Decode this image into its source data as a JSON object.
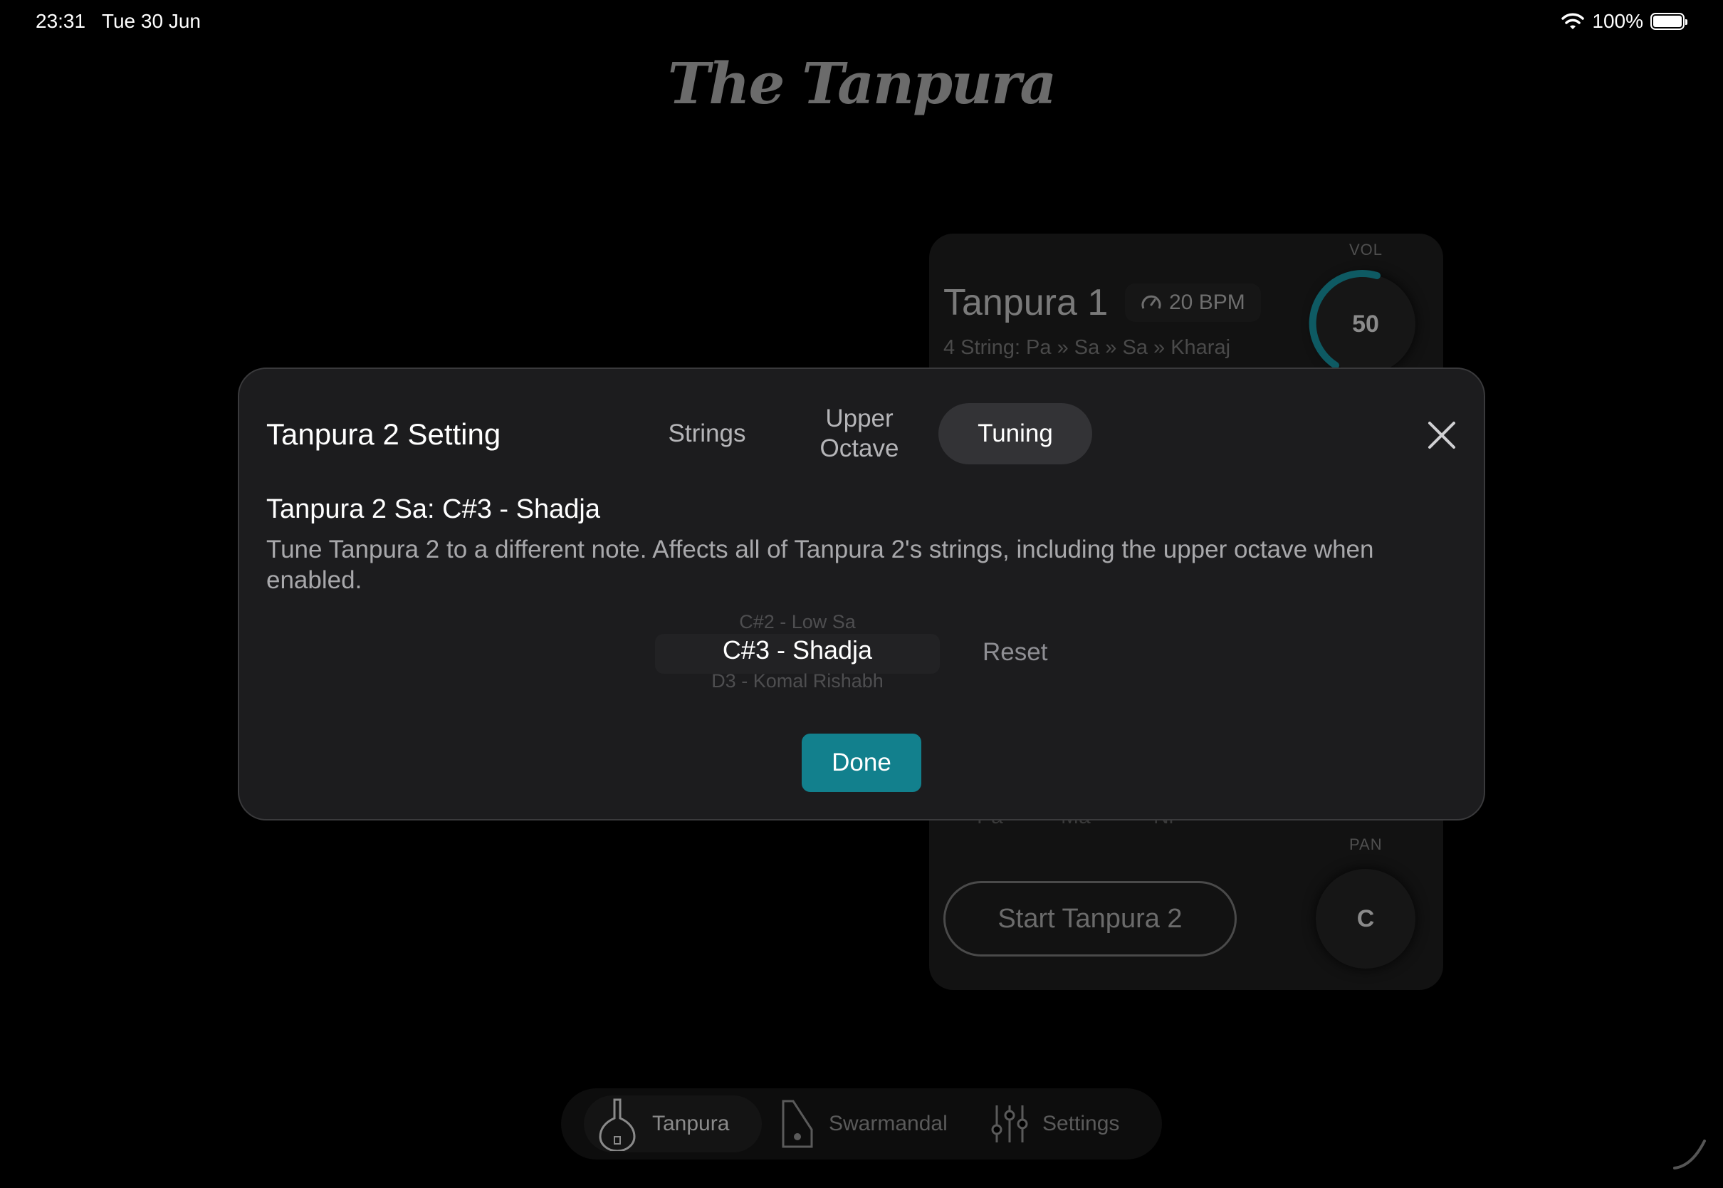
{
  "status": {
    "time": "23:31",
    "date": "Tue 30 Jun",
    "battery": "100%"
  },
  "app": {
    "logo": "The Tanpura"
  },
  "background_card": {
    "title": "Tanpura 1",
    "bpm": "20 BPM",
    "strings_summary": "4 String: Pa » Sa » Sa » Kharaj",
    "vol_label": "VOL",
    "vol_value": "50",
    "string_buttons": [
      "Pa",
      "Ma",
      "Ni"
    ],
    "pan_label": "PAN",
    "pan_value": "C",
    "start_button": "Start Tanpura 2"
  },
  "tabbar": {
    "items": [
      {
        "label": "Tanpura",
        "icon": "tanpura-icon",
        "active": true
      },
      {
        "label": "Swarmandal",
        "icon": "swarmandal-icon",
        "active": false
      },
      {
        "label": "Settings",
        "icon": "sliders-icon",
        "active": false
      }
    ]
  },
  "modal": {
    "title": "Tanpura 2 Setting",
    "tabs": [
      {
        "label": "Strings",
        "active": false
      },
      {
        "label": "Upper\nOctave",
        "active": false
      },
      {
        "label": "Tuning",
        "active": true
      }
    ],
    "close_icon": "close-icon",
    "sa_heading": "Tanpura 2 Sa: C#3 - Shadja",
    "description": "Tune Tanpura 2 to a different note. Affects all of Tanpura 2's strings, including the upper octave when enabled.",
    "picker": {
      "previous": "C#2 - Low Sa",
      "selected": "C#3 - Shadja",
      "next": "D3 - Komal Rishabh"
    },
    "reset_label": "Reset",
    "done_label": "Done"
  },
  "colors": {
    "accent": "#12808d",
    "modal_bg": "#1c1c1e",
    "knob_ring": "#0e5a63"
  }
}
